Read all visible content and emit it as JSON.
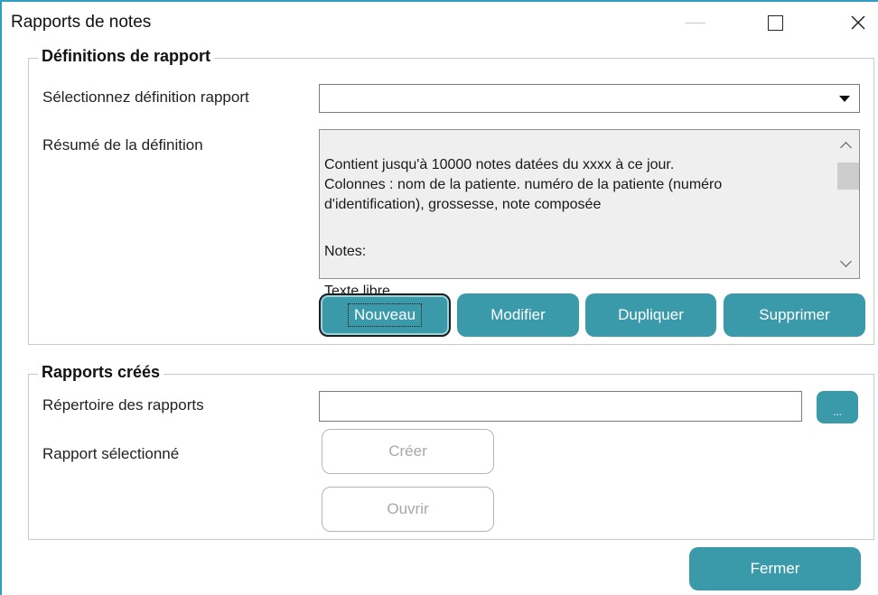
{
  "window": {
    "title": "Rapports de notes",
    "accent_color": "#2f9fc0"
  },
  "definitions_group": {
    "legend": "Définitions de rapport",
    "select_label": "Sélectionnez définition rapport",
    "select_value": "",
    "summary_label": "Résumé de la définition",
    "summary_text": "Contient jusqu'à 10000 notes datées du xxxx à ce jour.\nColonnes : nom de la patiente. numéro de la patiente (numéro d'identification), grossesse, note composée",
    "summary_notes_heading": "Notes:",
    "summary_notes_text": "Texte libre",
    "buttons": {
      "new": "Nouveau",
      "edit": "Modifier",
      "duplicate": "Dupliquer",
      "delete": "Supprimer"
    }
  },
  "reports_group": {
    "legend": "Rapports créés",
    "directory_label": "Répertoire des rapports",
    "directory_value": "",
    "browse_label": "...",
    "selected_label": "Rapport sélectionné",
    "create_label": "Créer",
    "open_label": "Ouvrir"
  },
  "footer": {
    "close_label": "Fermer"
  },
  "colors": {
    "button_teal": "#3a9aaa",
    "summary_bg": "#efefef",
    "disabled_text": "#a8a8a8"
  }
}
